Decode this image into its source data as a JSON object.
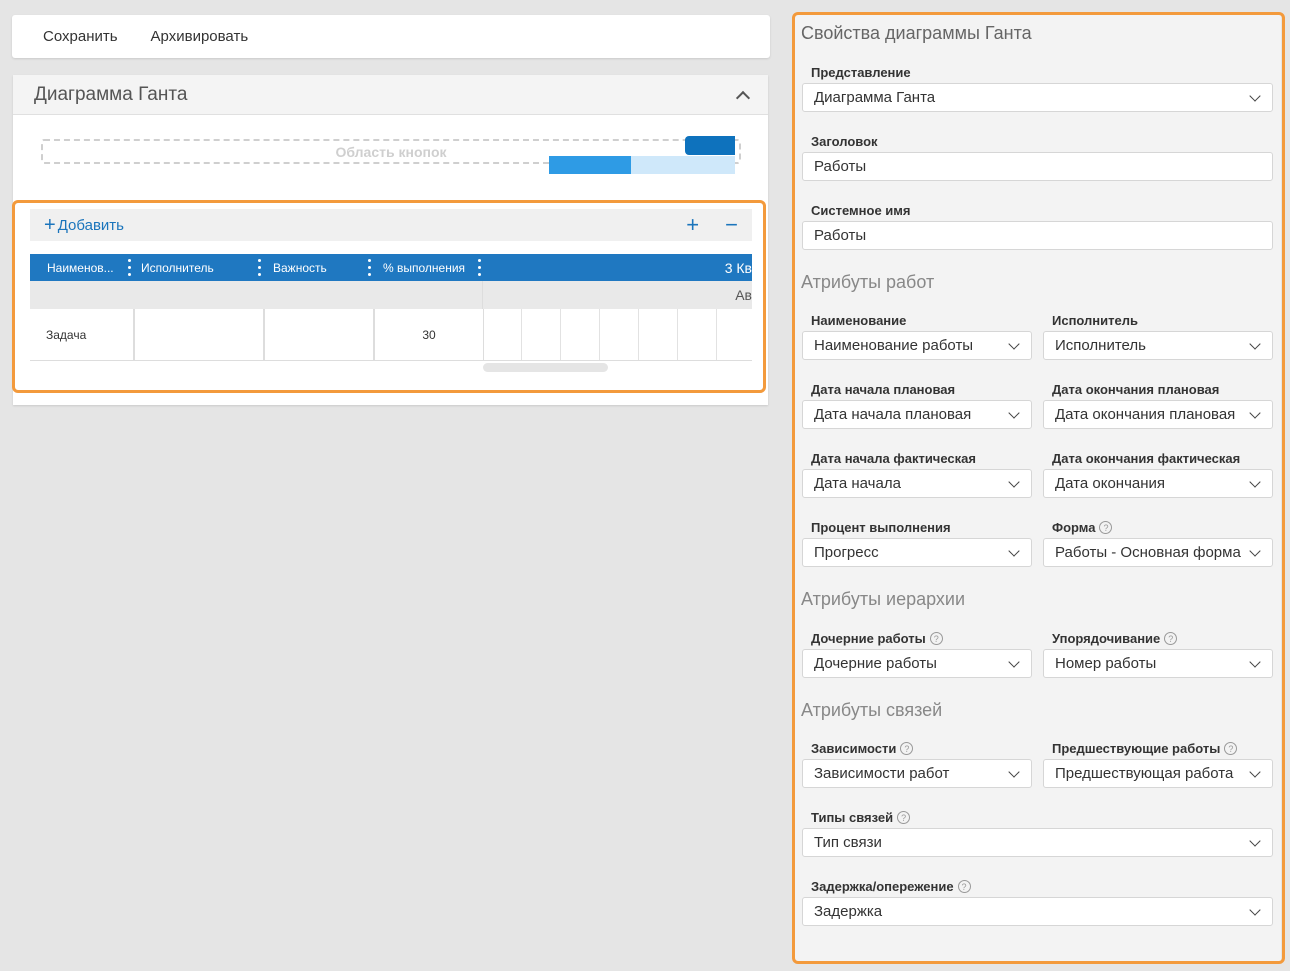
{
  "toolbar": {
    "save": "Сохранить",
    "archive": "Архивировать"
  },
  "panel": {
    "title": "Диаграмма Ганта",
    "buttons_area": "Область кнопок",
    "add": "Добавить",
    "columns": [
      "Наименов...",
      "Исполнитель",
      "Важность",
      "% выполнения"
    ],
    "timeline_header": "3 Кв",
    "timeline_sub": "Ав",
    "rows": [
      {
        "name": "Задача",
        "executor": "",
        "importance": "",
        "percent": "30"
      }
    ],
    "progress_fraction": 0.3
  },
  "props": {
    "title": "Свойства диаграммы Ганта",
    "view_label": "Представление",
    "view_value": "Диаграмма Ганта",
    "header_label": "Заголовок",
    "header_value": "Работы",
    "sysname_label": "Системное имя",
    "sysname_value": "Работы",
    "sec_work": "Атрибуты работ",
    "name_label": "Наименование",
    "name_value": "Наименование работы",
    "exec_label": "Исполнитель",
    "exec_value": "Исполнитель",
    "plan_start_label": "Дата начала плановая",
    "plan_start_value": "Дата начала плановая",
    "plan_end_label": "Дата окончания плановая",
    "plan_end_value": "Дата окончания плановая",
    "fact_start_label": "Дата начала фактическая",
    "fact_start_value": "Дата начала",
    "fact_end_label": "Дата окончания фактическая",
    "fact_end_value": "Дата окончания",
    "percent_label": "Процент выполнения",
    "percent_value": "Прогресс",
    "form_label": "Форма",
    "form_value": "Работы - Основная форма",
    "sec_hier": "Атрибуты иерархии",
    "child_label": "Дочерние работы",
    "child_value": "Дочерние работы",
    "order_label": "Упорядочивание",
    "order_value": "Номер работы",
    "sec_links": "Атрибуты связей",
    "dep_label": "Зависимости",
    "dep_value": "Зависимости работ",
    "pred_label": "Предшествующие работы",
    "pred_value": "Предшествующая работа",
    "linktype_label": "Типы связей",
    "linktype_value": "Тип связи",
    "delay_label": "Задержка/опережение",
    "delay_value": "Задержка"
  },
  "colors": {
    "accent": "#1f78c1",
    "highlight": "#f39a3c"
  }
}
